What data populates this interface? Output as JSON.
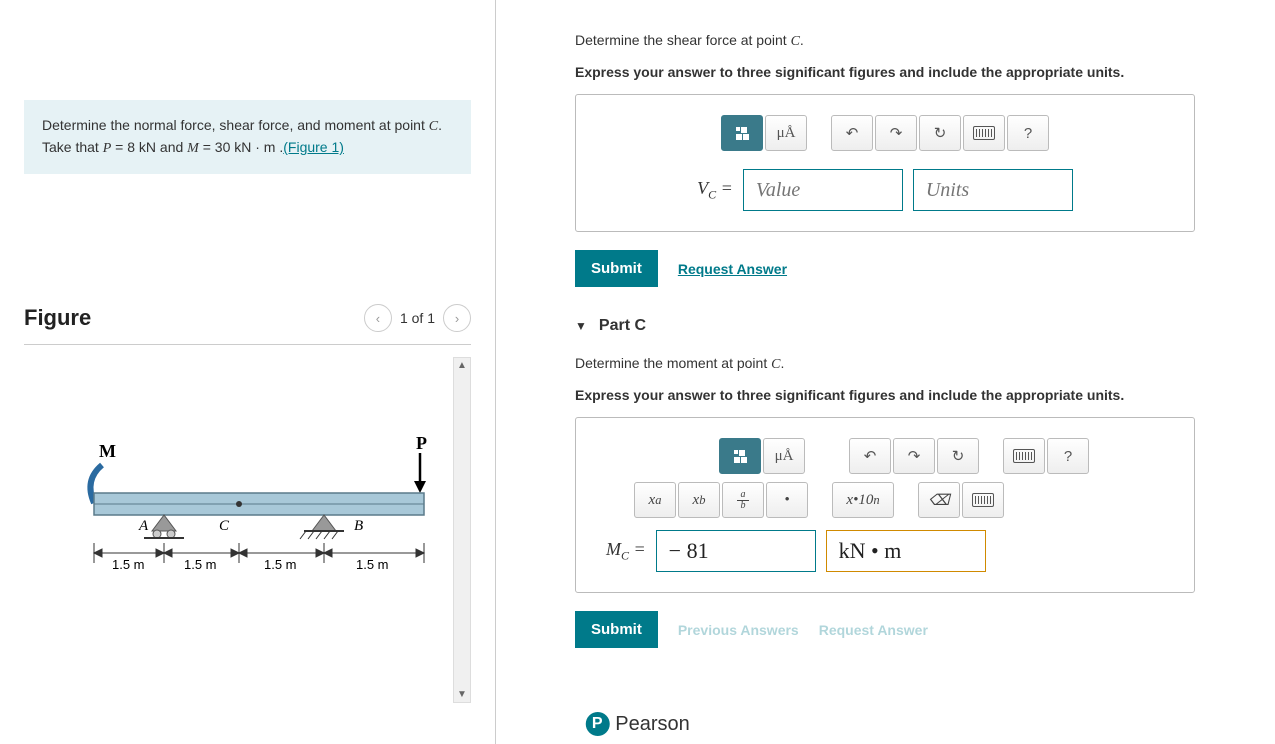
{
  "problem": {
    "prefix": "Determine the normal force, shear force, and moment at point ",
    "point": "C",
    "middle": ". Take that ",
    "p_var": "P",
    "p_eq": " = 8 kN",
    "and": " and ",
    "m_var": "M",
    "m_eq": " = 30 kN · m .",
    "figure_link": "(Figure 1)"
  },
  "figure": {
    "title": "Figure",
    "nav": "1 of 1",
    "labels": {
      "M": "M",
      "P": "P",
      "A": "A",
      "B": "B",
      "C": "C",
      "dim": "1.5 m"
    }
  },
  "partB": {
    "q1": "Determine the shear force at point ",
    "point": "C",
    "period": ".",
    "instruction": "Express your answer to three significant figures and include the appropriate units.",
    "label_var": "V",
    "label_sub": "C",
    "eq": " =",
    "value_placeholder": "Value",
    "units_placeholder": "Units",
    "submit": "Submit",
    "request": "Request Answer"
  },
  "partC": {
    "title": "Part C",
    "q1": "Determine the moment at point ",
    "point": "C",
    "period": ".",
    "instruction": "Express your answer to three significant figures and include the appropriate units.",
    "label_var": "M",
    "label_sub": "C",
    "eq": " =",
    "value": "− 81",
    "units": "kN • m",
    "submit": "Submit",
    "prev": "Previous Answers",
    "request": "Request Answer"
  },
  "toolbar": {
    "units_greek": "μÅ",
    "help": "?",
    "xa": "x",
    "xa_sup": "a",
    "xb": "x",
    "xb_sub": "b",
    "frac_a": "a",
    "frac_b": "b",
    "dot": "•",
    "sci": "x•10",
    "sci_sup": "n",
    "clear": "⌫"
  },
  "footer": {
    "logo": "P",
    "name": "Pearson"
  }
}
